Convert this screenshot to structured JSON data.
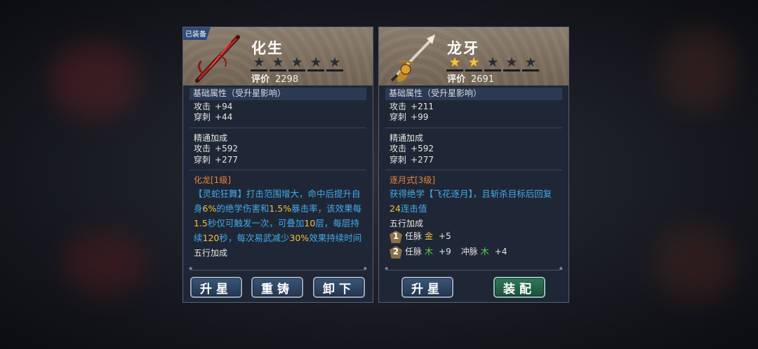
{
  "left_card": {
    "equipped_tag": "已装备",
    "name": "化生",
    "stars": [
      false,
      false,
      false,
      false,
      false
    ],
    "rating_label": "评价",
    "rating_value": "2298",
    "base_title": "基础属性（受升星影响）",
    "base_stats": [
      {
        "label": "攻击",
        "value": "+94"
      },
      {
        "label": "穿刺",
        "value": "+44"
      }
    ],
    "mastery_title": "精通加成",
    "mastery_stats": [
      {
        "label": "攻击",
        "value": "+592"
      },
      {
        "label": "穿刺",
        "value": "+277"
      }
    ],
    "skill_name": "化龙[1级]",
    "skill_desc": {
      "p1": "【灵蛇狂舞】打击范围增大，命中后提升自身",
      "n1": "6%",
      "p2": "的绝学伤害和",
      "n2": "1.5%",
      "p3": "暴击率，该效果每",
      "n3": "1.5",
      "p4": "秒仅可触发一次，可叠加",
      "n4": "10",
      "p5": "层，每层持续",
      "n5": "120",
      "p6": "秒，每次易武减少",
      "n6": "30%",
      "p7": "效果持续时间"
    },
    "wuxing_title": "五行加成",
    "buttons": {
      "upstar": "升星",
      "recast": "重铸",
      "unequip": "卸下"
    }
  },
  "right_card": {
    "name": "龙牙",
    "stars": [
      true,
      true,
      false,
      false,
      false
    ],
    "rating_label": "评价",
    "rating_value": "2691",
    "base_title": "基础属性（受升星影响）",
    "base_stats": [
      {
        "label": "攻击",
        "value": "+211"
      },
      {
        "label": "穿刺",
        "value": "+99"
      }
    ],
    "mastery_title": "精通加成",
    "mastery_stats": [
      {
        "label": "攻击",
        "value": "+592"
      },
      {
        "label": "穿刺",
        "value": "+277"
      }
    ],
    "skill_name": "逐月式[3级]",
    "skill_desc": {
      "p1": "获得绝学【飞花逐月】，且斩杀目标后回复",
      "n1": "24",
      "p2": "连击值"
    },
    "wuxing_title": "五行加成",
    "wuxing": [
      {
        "num": "1",
        "a_label": "任脉",
        "a_elem": "金",
        "a_val": "+5",
        "b_label": "",
        "b_elem": "",
        "b_val": ""
      },
      {
        "num": "2",
        "a_label": "任脉",
        "a_elem": "木",
        "a_val": "+9",
        "b_label": "冲脉",
        "b_elem": "木",
        "b_val": "+4"
      }
    ],
    "buttons": {
      "upstar": "升星",
      "equip": "装配"
    }
  },
  "colors": {
    "star_on": "#f1c24a",
    "skill_name": "#e8833a",
    "skill_desc": "#44a8e8",
    "highlight": "#f0c040",
    "wood": "#52d04a",
    "metal": "#e8c040"
  }
}
